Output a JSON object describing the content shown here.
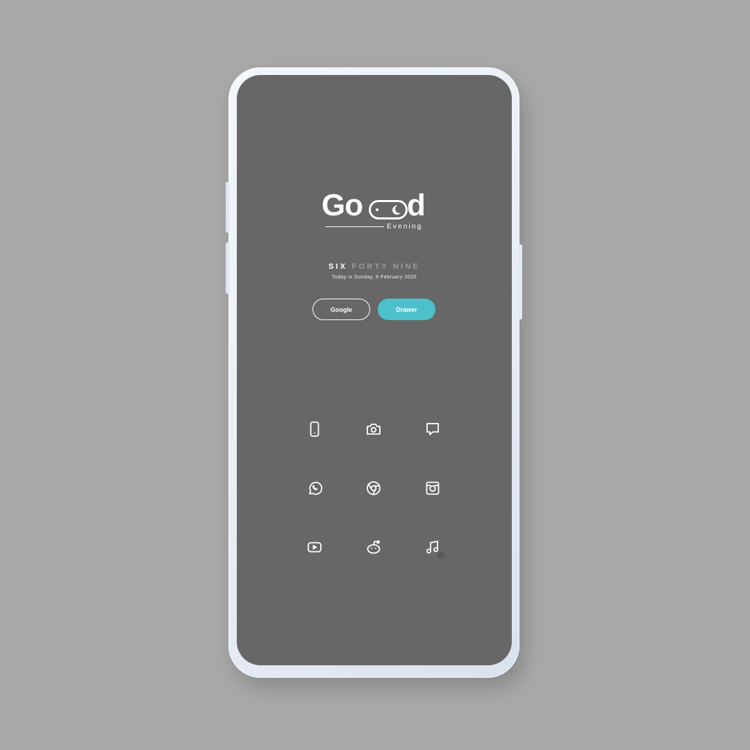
{
  "greeting": {
    "go": "Go",
    "d": "d",
    "subtitle": "Evening"
  },
  "clock": {
    "hour_word": "SIX",
    "minute_words": "FORTY NINE",
    "date_line": "Today is Sunday, 9 February 2020"
  },
  "buttons": {
    "google_label": "Google",
    "drawer_label": "Drawer",
    "drawer_color": "#4cc1cc"
  },
  "dock_icons": [
    {
      "name": "phone-icon"
    },
    {
      "name": "camera-icon"
    },
    {
      "name": "messages-icon"
    },
    {
      "name": "whatsapp-icon"
    },
    {
      "name": "chrome-icon"
    },
    {
      "name": "instagram-icon"
    },
    {
      "name": "youtube-icon"
    },
    {
      "name": "reddit-icon"
    },
    {
      "name": "music-icon"
    }
  ],
  "colors": {
    "background": "#a8a8a8",
    "screen": "#676767",
    "accent": "#4cc1cc"
  }
}
